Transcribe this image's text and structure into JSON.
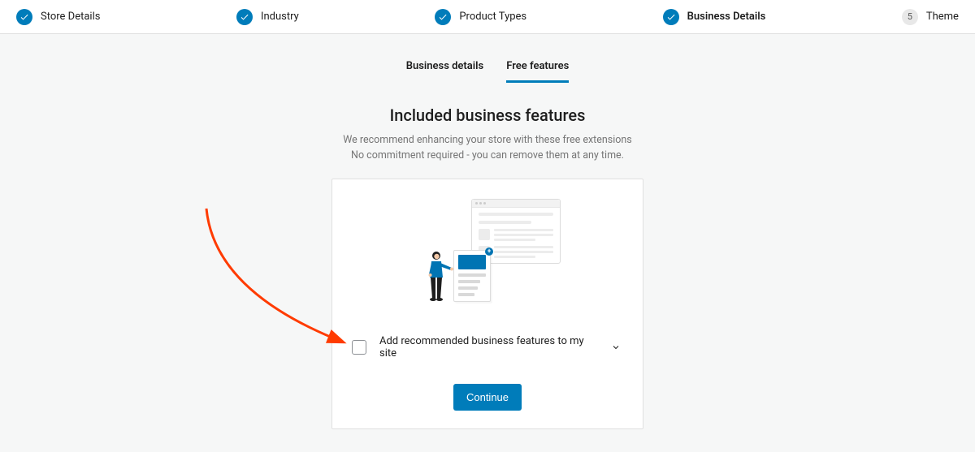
{
  "stepper": {
    "steps": [
      {
        "label": "Store Details",
        "completed": true
      },
      {
        "label": "Industry",
        "completed": true
      },
      {
        "label": "Product Types",
        "completed": true
      },
      {
        "label": "Business Details",
        "completed": true,
        "bold": true
      },
      {
        "label": "Theme",
        "number": "5"
      }
    ]
  },
  "subtabs": {
    "tab1": "Business details",
    "tab2": "Free features"
  },
  "heading": "Included business features",
  "subheading_line1": "We recommend enhancing your store with these free extensions",
  "subheading_line2": "No commitment required - you can remove them at any time.",
  "checkbox": {
    "label": "Add recommended business features to my site"
  },
  "continue_label": "Continue",
  "colors": {
    "primary": "#007cba",
    "text": "#1e1e1e",
    "muted": "#757575"
  }
}
